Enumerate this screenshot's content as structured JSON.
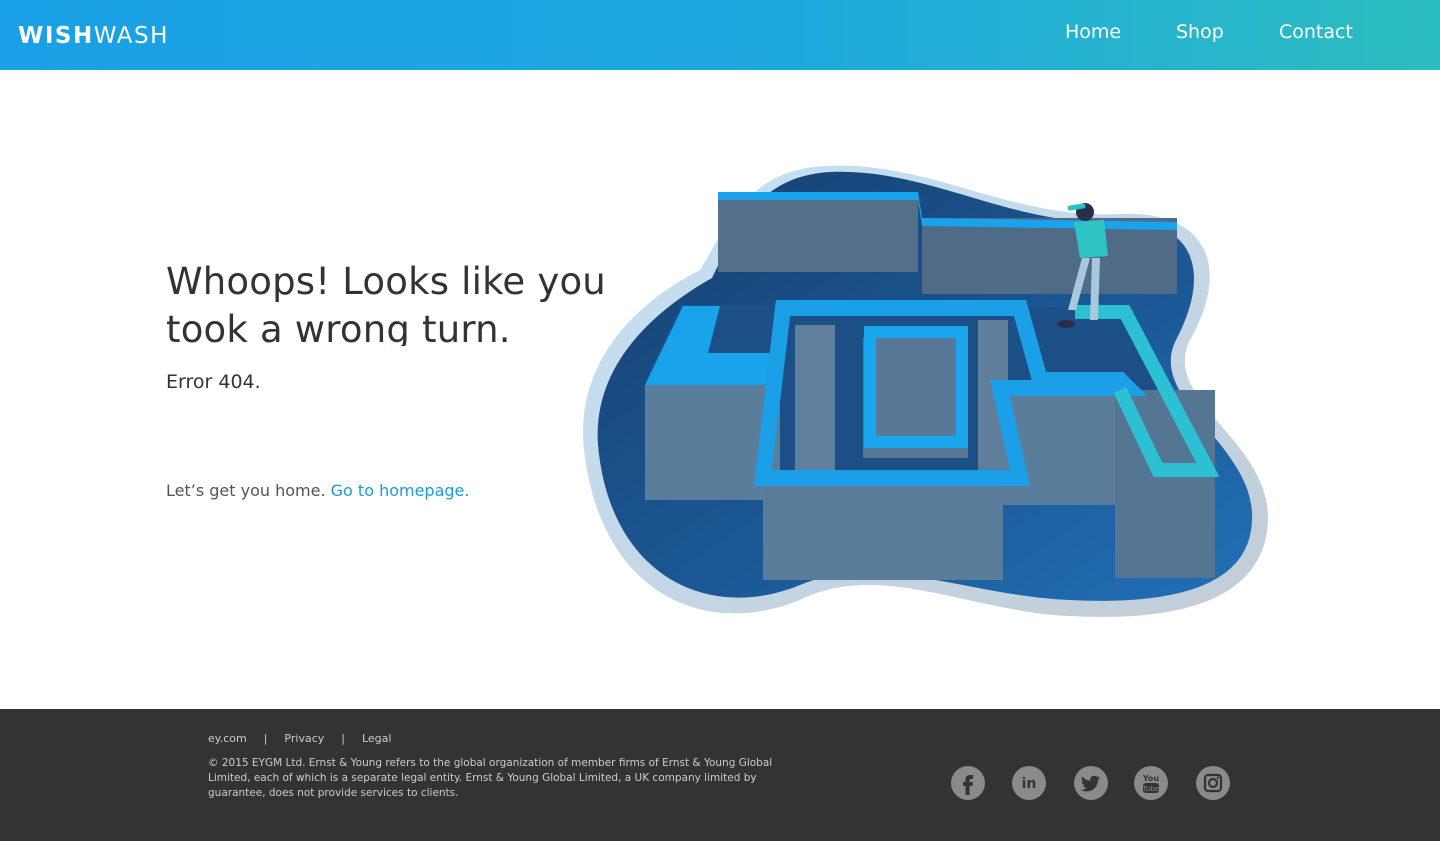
{
  "header": {
    "logo_bold": "WISH",
    "logo_light": "WASH",
    "nav": [
      "Home",
      "Shop",
      "Contact"
    ]
  },
  "main": {
    "headline": "Whoops! Looks like you took a wrong turn.",
    "error": "Error 404.",
    "prompt": "Let’s get you home.",
    "link": "Go to homepage."
  },
  "footer": {
    "links": [
      "ey.com",
      "Privacy",
      "Legal"
    ],
    "separator": "|",
    "copyright": "© 2015 EYGM Ltd. Ernst & Young refers to the global organization of member firms of Ernst & Young Global Limited, each of which is a separate legal entity. Ernst & Young Global Limited, a UK company limited by guarantee, does not provide services to clients.",
    "social": [
      "facebook-icon",
      "linkedin-icon",
      "twitter-icon",
      "youtube-icon",
      "instagram-icon"
    ],
    "youtube_text": [
      "You",
      "Tube"
    ],
    "linkedin_text": "in"
  },
  "colors": {
    "header_start": "#1aa0e6",
    "header_end": "#2cbdc0",
    "link": "#1a9bd7",
    "footer_bg": "#333333",
    "maze_dark": "#1b4f86",
    "maze_wall": "#5b7d9c",
    "maze_edge": "#19a3ea"
  }
}
